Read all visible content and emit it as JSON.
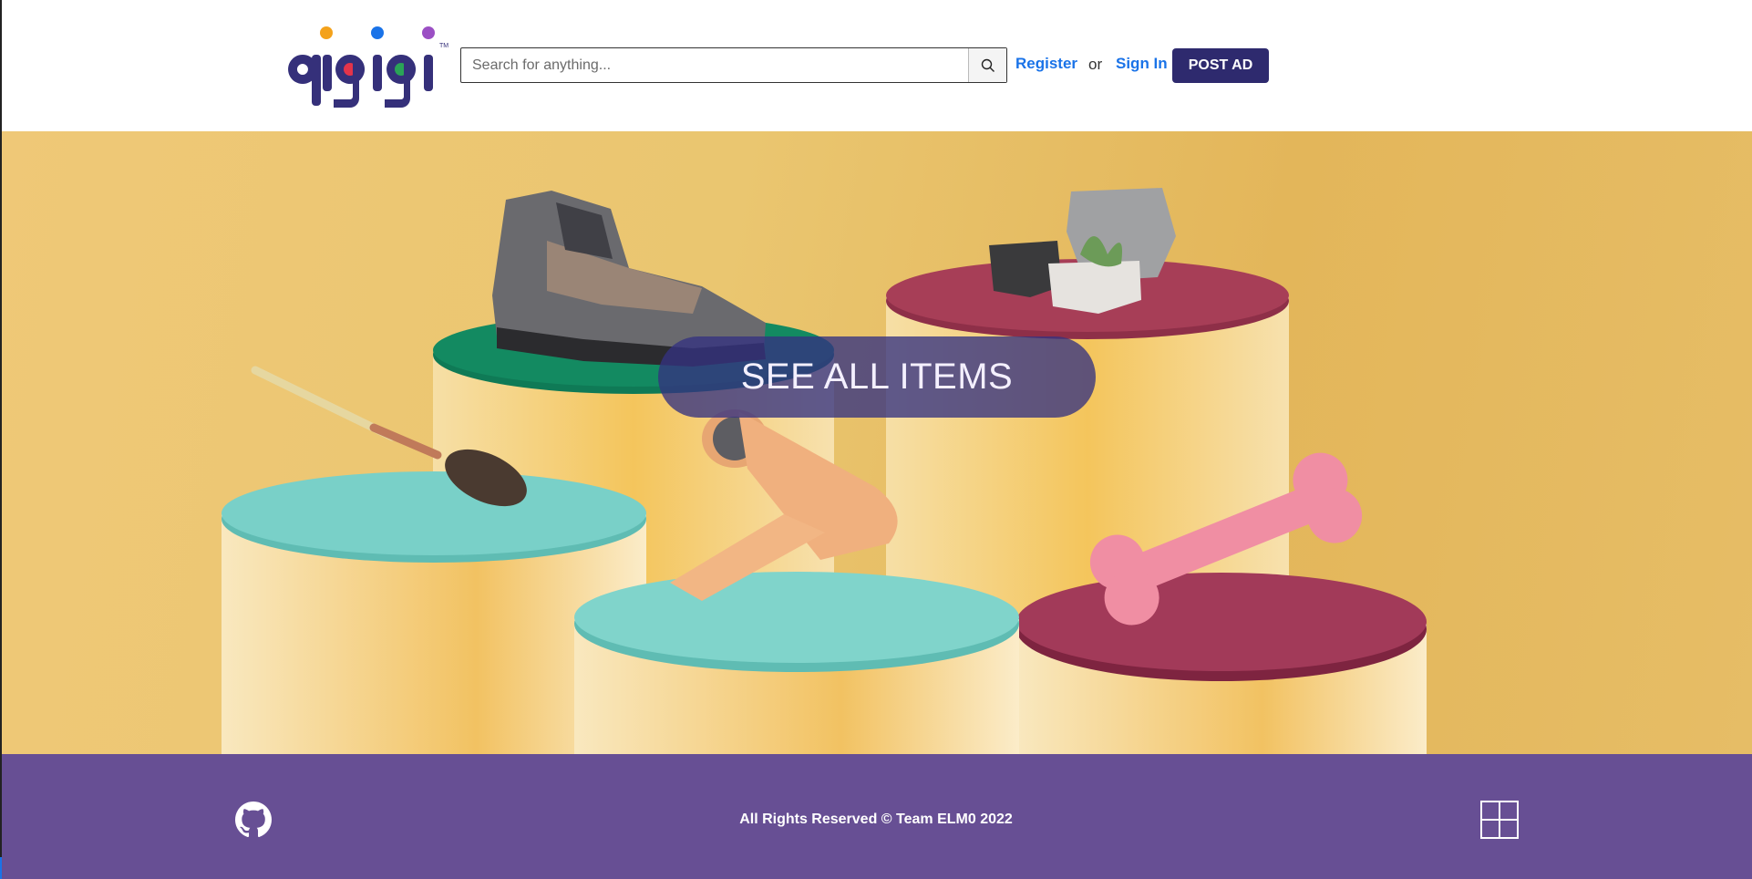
{
  "header": {
    "logo_text": "qigigi",
    "search": {
      "placeholder": "Search for anything...",
      "value": "",
      "icon": "search-icon"
    },
    "register_label": "Register",
    "or_text": "or",
    "signin_label": "Sign In",
    "post_ad_label": "POST AD"
  },
  "hero": {
    "cta_label": "SEE ALL ITEMS"
  },
  "footer": {
    "github_icon": "github-icon",
    "copyright": "All Rights Reserved © Team ELM0 2022",
    "right_icon": "windows-grid-icon"
  },
  "colors": {
    "brand_purple": "#2e2a6e",
    "link_blue": "#1a73e8",
    "footer_purple": "#674f94",
    "hero_yellow": "#eac670"
  }
}
